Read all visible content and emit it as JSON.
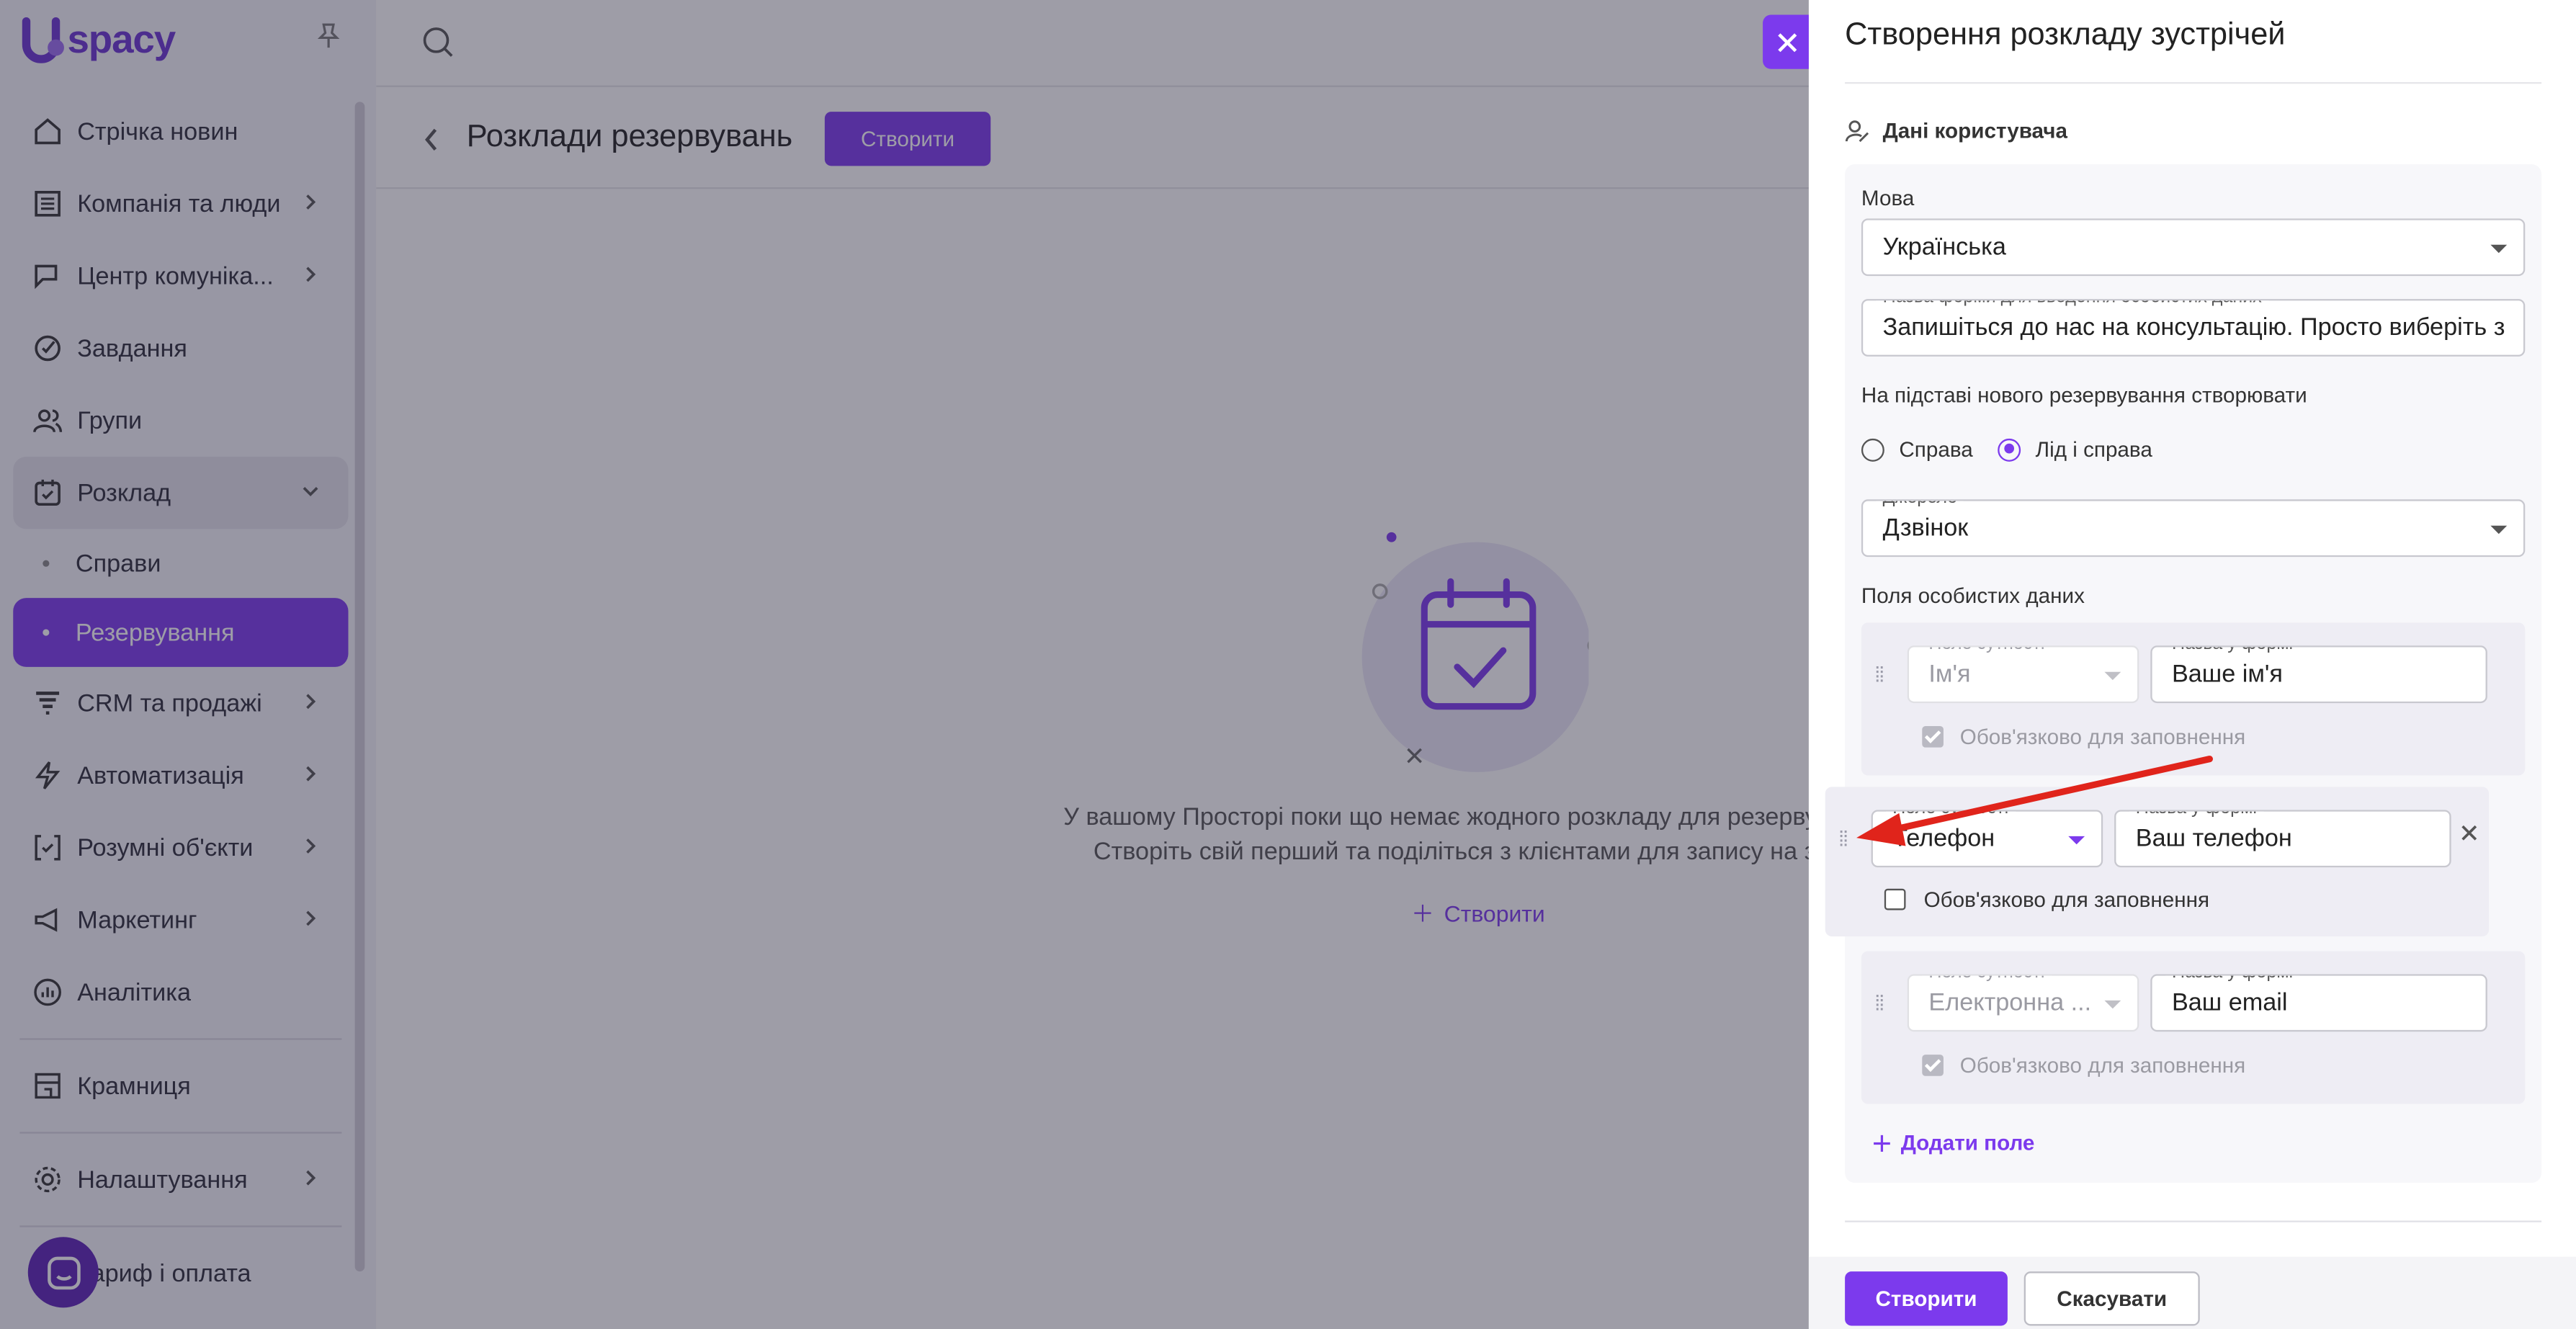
{
  "app": {
    "logo_text": "spacy"
  },
  "sidebar": {
    "items": [
      {
        "label": "Стрічка новин",
        "icon": "home-icon"
      },
      {
        "label": "Компанія та люди",
        "icon": "building-icon"
      },
      {
        "label": "Центр комуніка...",
        "icon": "chat-edit-icon"
      },
      {
        "label": "Завдання",
        "icon": "check-circle-icon"
      },
      {
        "label": "Групи",
        "icon": "users-icon"
      },
      {
        "label": "Розклад",
        "icon": "calendar-check-icon"
      },
      {
        "label": "Справи"
      },
      {
        "label": "Резервування"
      },
      {
        "label": "CRM та продажі",
        "icon": "funnel-icon"
      },
      {
        "label": "Автоматизація",
        "icon": "bolt-icon"
      },
      {
        "label": "Розумні об'єкти",
        "icon": "bracket-icon"
      },
      {
        "label": "Маркетинг",
        "icon": "megaphone-icon"
      },
      {
        "label": "Аналітика",
        "icon": "chart-icon"
      },
      {
        "label": "Крамниця",
        "icon": "store-icon"
      },
      {
        "label": "Налаштування",
        "icon": "gear-icon"
      },
      {
        "label": "Тариф і оплата",
        "icon": "card-icon"
      }
    ]
  },
  "main": {
    "title": "Розклади резервувань",
    "create_label": "Створити",
    "empty_line1": "У вашому Просторі поки що немає жодного розкладу для резервуван",
    "empty_line2": "Створіть свій перший та поділіться з клієнтами для запису на зу",
    "empty_create": "Створити"
  },
  "panel": {
    "title": "Створення розкладу зустрічей",
    "section_title": "Дані користувача",
    "language_label": "Мова",
    "language_value": "Українська",
    "form_name_label": "Назва форми для введення особистих даних",
    "form_name_value": "Запишіться до нас на консультацію. Просто виберіть з",
    "create_basis_label": "На підставі нового резервування створювати",
    "radio_option_1": "Справа",
    "radio_option_2": "Лід і справа",
    "radio_selected": "Лід і справа",
    "source_label": "Джерело",
    "source_value": "Дзвінок",
    "personal_fields_label": "Поля особистих даних",
    "fields": [
      {
        "entity_label": "Поле сутності",
        "entity_value": "Ім'я",
        "form_label": "Назва у формі",
        "form_value": "Ваше ім'я",
        "required_label": "Обов'язково для заповнення",
        "required": true,
        "locked": true
      },
      {
        "entity_label": "Поле сутності",
        "entity_value": "Телефон",
        "form_label": "Назва у формі",
        "form_value": "Ваш телефон",
        "required_label": "Обов'язково для заповнення",
        "required": false,
        "locked": false
      },
      {
        "entity_label": "Поле сутності",
        "entity_value": "Електронна ...",
        "form_label": "Назва у формі",
        "form_value": "Ваш email",
        "required_label": "Обов'язково для заповнення",
        "required": true,
        "locked": true
      }
    ],
    "add_field_label": "Додати поле",
    "submit_label": "Створити",
    "cancel_label": "Скасувати"
  },
  "colors": {
    "accent": "#7c3aed",
    "arrow": "#e0241b"
  }
}
